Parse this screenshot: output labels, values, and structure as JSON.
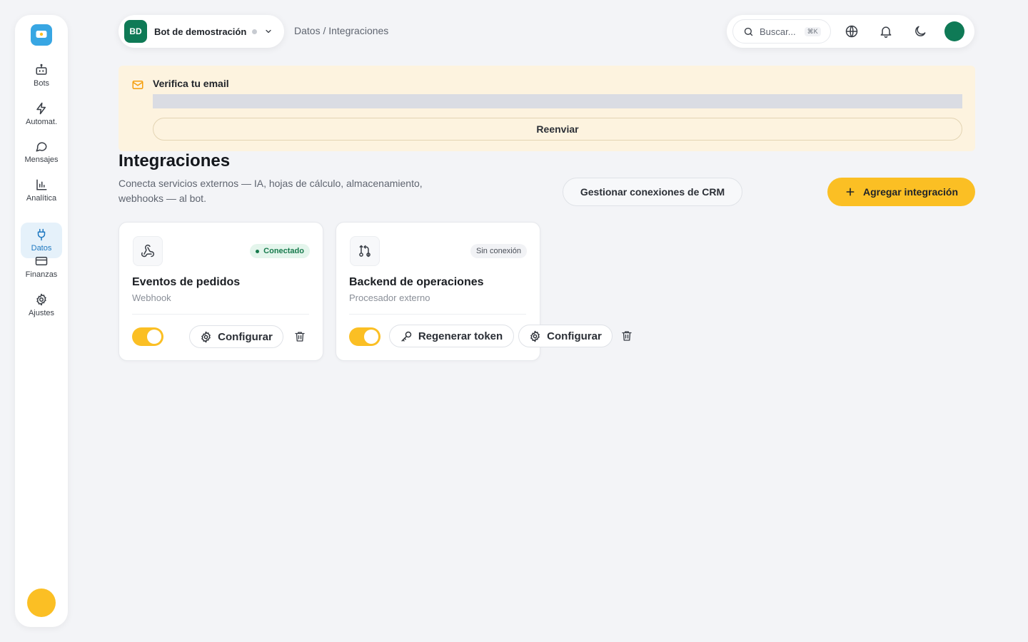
{
  "sidebar": {
    "logo_icon": "chat-bubble-logo",
    "items": [
      {
        "label": "Bots",
        "icon": "robot-icon",
        "active": false
      },
      {
        "label": "Automat.",
        "icon": "lightning-icon",
        "active": false
      },
      {
        "label": "Mensajes",
        "icon": "message-icon",
        "active": false
      },
      {
        "label": "Analítica",
        "icon": "bar-chart-icon",
        "active": false
      },
      {
        "label": "Datos",
        "icon": "plug-icon",
        "active": true
      },
      {
        "label": "Finanzas",
        "icon": "card-icon",
        "active": false
      },
      {
        "label": "Ajustes",
        "icon": "gear-icon",
        "active": false
      }
    ]
  },
  "topbar": {
    "bot_initials": "BD",
    "bot_name": "Bot de demostración",
    "breadcrumb": "Datos / Integraciones",
    "search_placeholder": "Buscar...",
    "search_shortcut": "⌘K",
    "icons": [
      "globe-icon",
      "bell-icon",
      "moon-icon"
    ]
  },
  "banner": {
    "title": "Verifica tu email",
    "resend_label": "Reenviar"
  },
  "page": {
    "title": "Integraciones",
    "description": "Conecta servicios externos — IA, hojas de cálculo, almacenamiento, webhooks — al bot.",
    "crm_button": "Gestionar conexiones de CRM",
    "add_button": "Agregar integración"
  },
  "cards": [
    {
      "title": "Eventos de pedidos",
      "subtitle": "Webhook",
      "status": "Conectado",
      "enabled": true,
      "configure_label": "Configurar"
    },
    {
      "title": "Backend de operaciones",
      "subtitle": "Procesador externo",
      "status": "Sin conexión",
      "enabled": true,
      "token_label": "Regenerar token",
      "configure_label": "Configurar"
    }
  ],
  "colors": {
    "accent": "#fbbf24",
    "brand_green": "#0f7a56",
    "active_blue": "#1e78c0",
    "background": "#f3f4f7"
  }
}
